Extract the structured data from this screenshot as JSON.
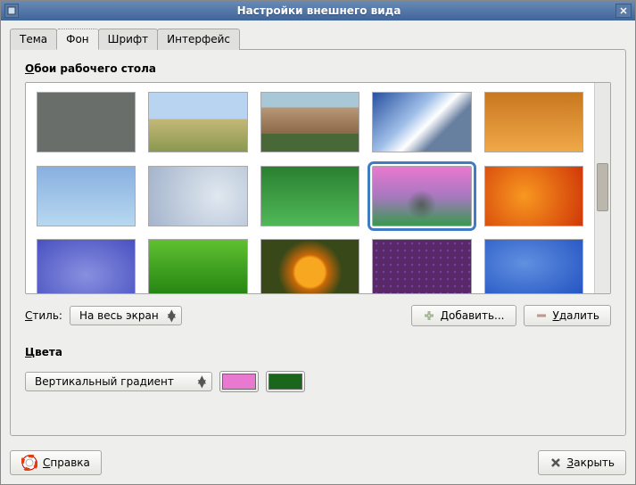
{
  "window": {
    "title": "Настройки внешнего вида"
  },
  "tabs": {
    "theme": "Тема",
    "background": "Фон",
    "font": "Шрифт",
    "interface": "Интерфейс"
  },
  "section": {
    "wallpaper_label_ul": "О",
    "wallpaper_label_rest": "бои рабочего стола",
    "colors_label_ul": "Ц",
    "colors_label_rest": "вета"
  },
  "style": {
    "label_ul": "С",
    "label_rest": "тиль:",
    "value": "На весь экран"
  },
  "buttons": {
    "add_ul": "Д",
    "add_rest": "обавить...",
    "remove_ul": "У",
    "remove_rest": "далить",
    "help_ul": "С",
    "help_rest": "правка",
    "close_ul": "З",
    "close_rest": "акрыть"
  },
  "gradient": {
    "value": "Вертикальный градиент",
    "color1": "#e878d0",
    "color2": "#1a661a"
  },
  "wallpapers": {
    "selected_index": 8
  }
}
